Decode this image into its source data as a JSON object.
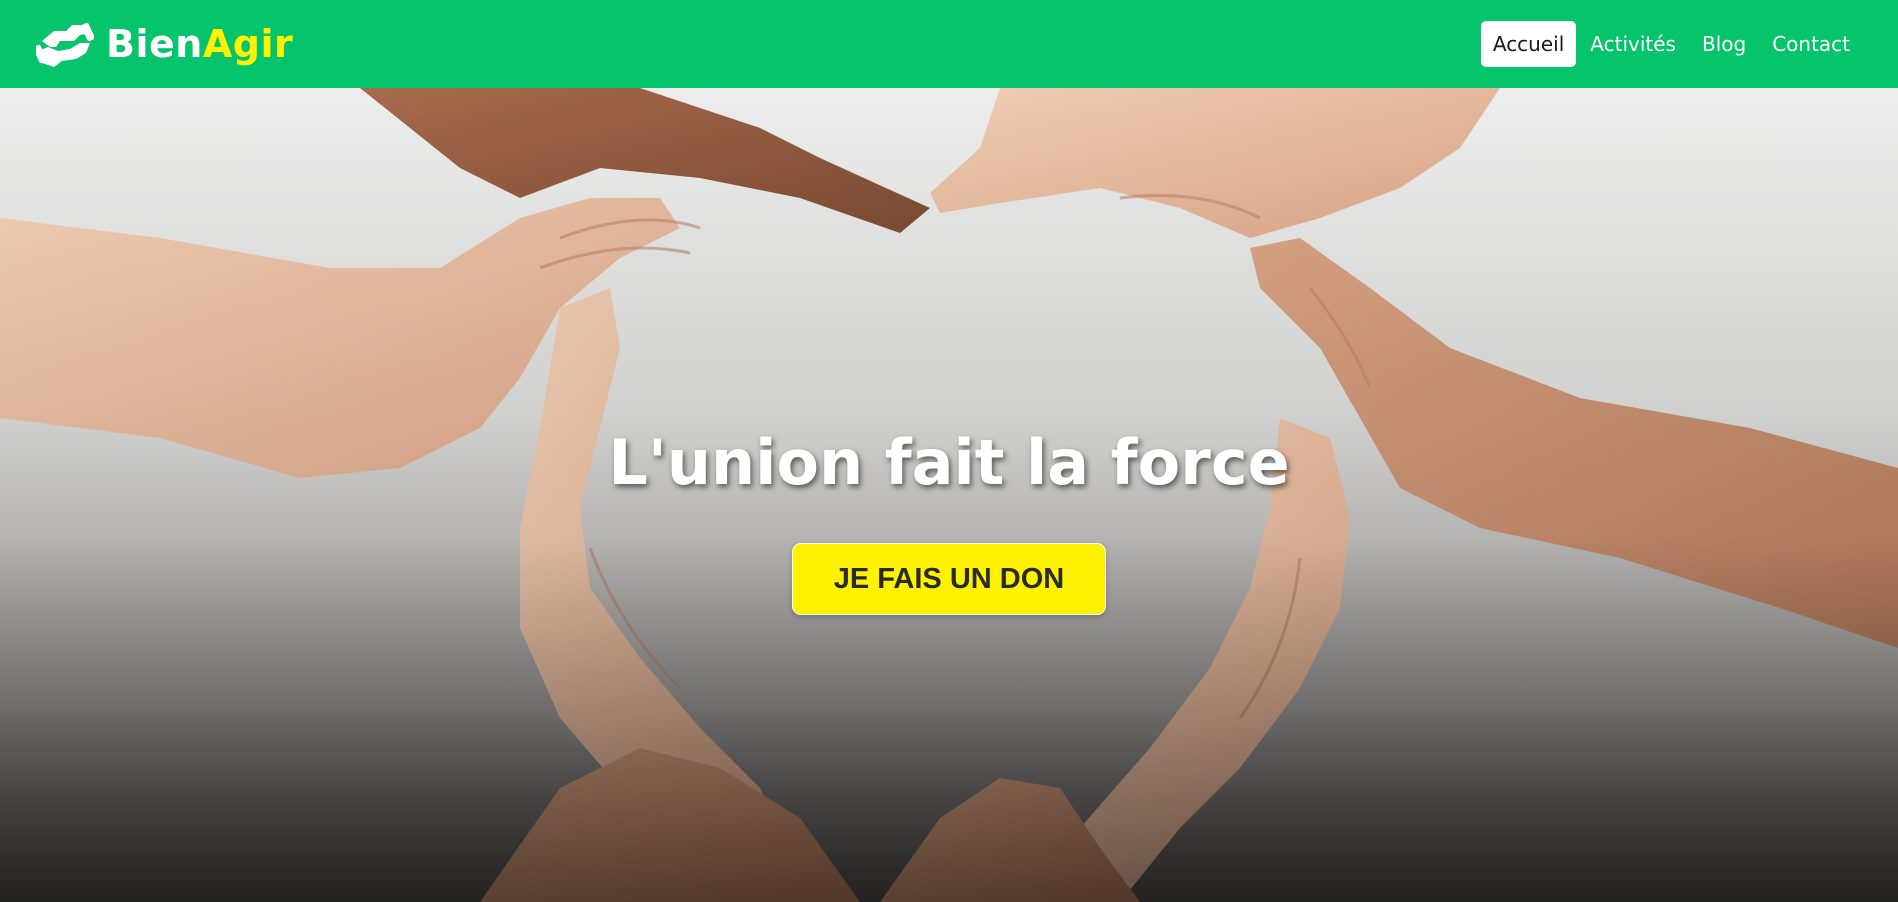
{
  "brand": {
    "name_part1": "Bien",
    "name_part2": "Agir",
    "icon": "handshake-icon"
  },
  "nav": {
    "items": [
      {
        "label": "Accueil",
        "active": true
      },
      {
        "label": "Activités",
        "active": false
      },
      {
        "label": "Blog",
        "active": false
      },
      {
        "label": "Contact",
        "active": false
      }
    ]
  },
  "hero": {
    "title": "L'union fait la force",
    "cta_label": "JE FAIS UN DON",
    "image": "heart-of-hands-image"
  },
  "colors": {
    "nav_background": "#06c46c",
    "brand_accent": "#fff200",
    "cta_background": "#fff200",
    "cta_text": "#2a2a2a"
  }
}
